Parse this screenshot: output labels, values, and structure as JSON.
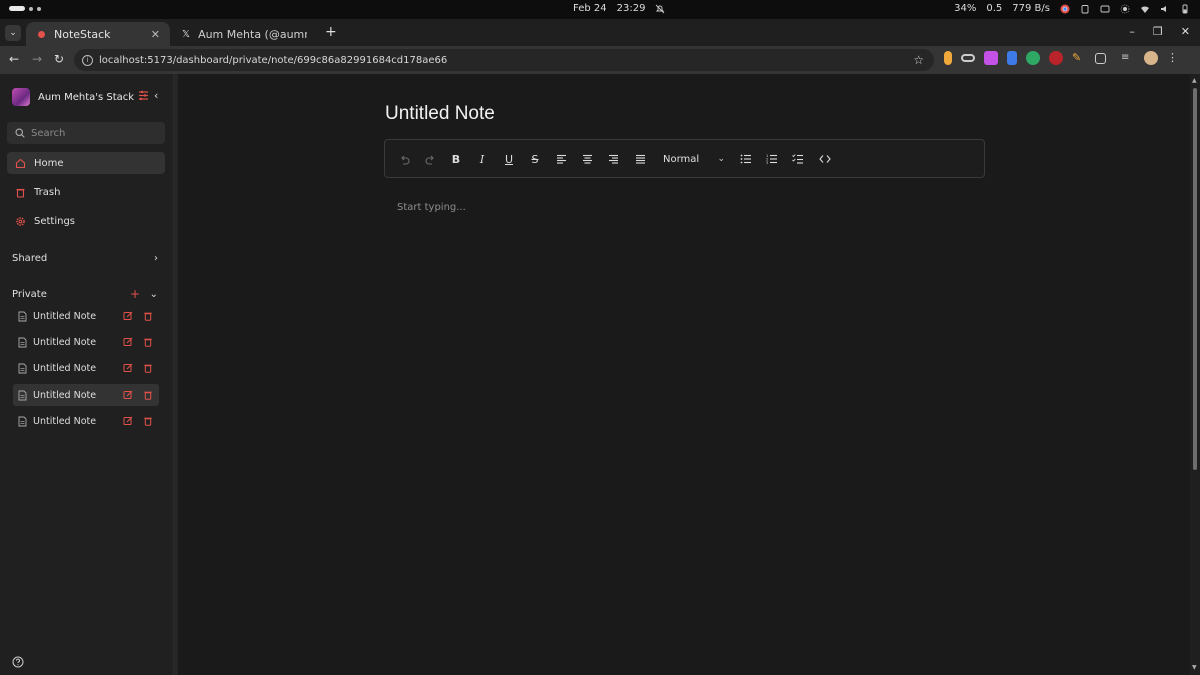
{
  "os": {
    "date": "Feb 24",
    "time": "23:29",
    "battery": "34%",
    "load": "0.5",
    "net_speed": "779 B/s"
  },
  "browser": {
    "tabs": [
      {
        "label": "NoteStack",
        "active": true
      },
      {
        "label": "Aum Mehta (@aummeht",
        "active": false
      }
    ],
    "url": "localhost:5173/dashboard/private/note/699c86a82991684cd178ae66"
  },
  "sidebar": {
    "workspace_title": "Aum Mehta's Stack",
    "search_placeholder": "Search",
    "nav": [
      {
        "label": "Home",
        "icon": "home-icon",
        "active": true
      },
      {
        "label": "Trash",
        "icon": "trash-icon",
        "active": false
      },
      {
        "label": "Settings",
        "icon": "gear-icon",
        "active": false
      }
    ],
    "shared_label": "Shared",
    "private_label": "Private",
    "notes": [
      {
        "title": "Untitled Note",
        "selected": false
      },
      {
        "title": "Untitled Note",
        "selected": false
      },
      {
        "title": "Untitled Note",
        "selected": false
      },
      {
        "title": "Untitled Note",
        "selected": true
      },
      {
        "title": "Untitled Note",
        "selected": false
      }
    ]
  },
  "editor": {
    "title": "Untitled Note",
    "block_type": "Normal",
    "placeholder": "Start typing..."
  },
  "colors": {
    "accent": "#e2524a",
    "background": "#1a1a1a",
    "sidebar": "#202020"
  }
}
